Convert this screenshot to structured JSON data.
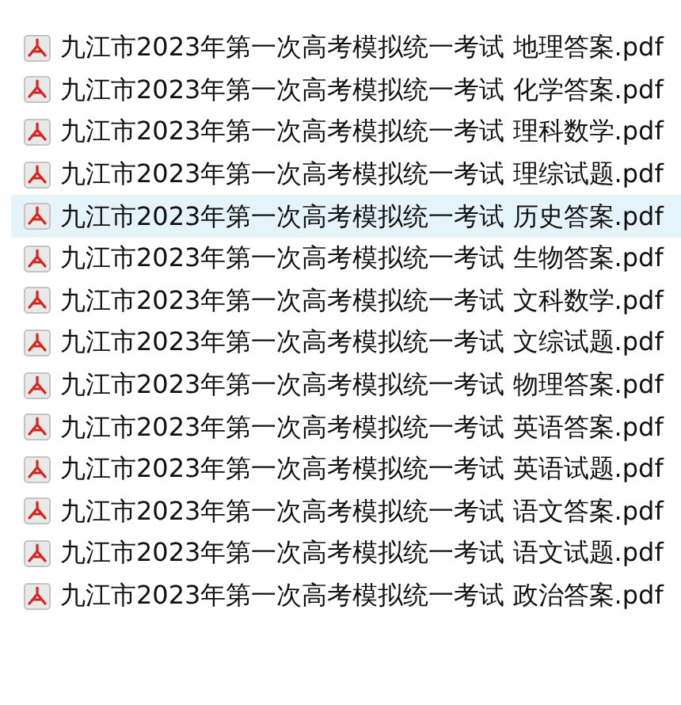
{
  "files": [
    {
      "name": "九江市2023年第一次高考模拟统一考试 地理答案.pdf",
      "selected": false
    },
    {
      "name": "九江市2023年第一次高考模拟统一考试 化学答案.pdf",
      "selected": false
    },
    {
      "name": "九江市2023年第一次高考模拟统一考试 理科数学.pdf",
      "selected": false
    },
    {
      "name": "九江市2023年第一次高考模拟统一考试 理综试题.pdf",
      "selected": false
    },
    {
      "name": "九江市2023年第一次高考模拟统一考试 历史答案.pdf",
      "selected": true
    },
    {
      "name": "九江市2023年第一次高考模拟统一考试 生物答案.pdf",
      "selected": false
    },
    {
      "name": "九江市2023年第一次高考模拟统一考试 文科数学.pdf",
      "selected": false
    },
    {
      "name": "九江市2023年第一次高考模拟统一考试 文综试题.pdf",
      "selected": false
    },
    {
      "name": "九江市2023年第一次高考模拟统一考试 物理答案.pdf",
      "selected": false
    },
    {
      "name": "九江市2023年第一次高考模拟统一考试 英语答案.pdf",
      "selected": false
    },
    {
      "name": "九江市2023年第一次高考模拟统一考试 英语试题.pdf",
      "selected": false
    },
    {
      "name": "九江市2023年第一次高考模拟统一考试 语文答案.pdf",
      "selected": false
    },
    {
      "name": "九江市2023年第一次高考模拟统一考试 语文试题.pdf",
      "selected": false
    },
    {
      "name": "九江市2023年第一次高考模拟统一考试 政治答案.pdf",
      "selected": false
    }
  ]
}
